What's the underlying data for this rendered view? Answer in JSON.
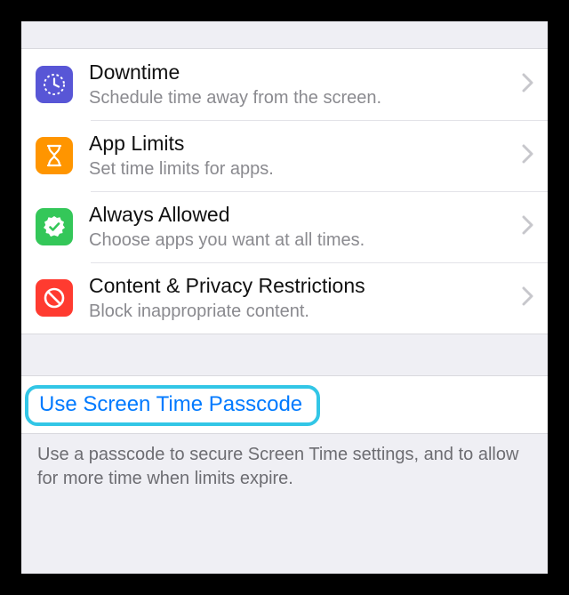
{
  "screen": {
    "items": [
      {
        "key": "downtime",
        "title": "Downtime",
        "subtitle": "Schedule time away from the screen.",
        "iconName": "downtime-icon",
        "iconBg": "#5856d6"
      },
      {
        "key": "app-limits",
        "title": "App Limits",
        "subtitle": "Set time limits for apps.",
        "iconName": "hourglass-icon",
        "iconBg": "#ff9500"
      },
      {
        "key": "always-allowed",
        "title": "Always Allowed",
        "subtitle": "Choose apps you want at all times.",
        "iconName": "check-badge-icon",
        "iconBg": "#34c759"
      },
      {
        "key": "content-restrictions",
        "title": "Content & Privacy Restrictions",
        "subtitle": "Block inappropriate content.",
        "iconName": "no-entry-icon",
        "iconBg": "#ff3b30"
      }
    ],
    "passcodeLink": "Use Screen Time Passcode",
    "passcodeFooter": "Use a passcode to secure Screen Time settings, and to allow for more time when limits expire."
  }
}
